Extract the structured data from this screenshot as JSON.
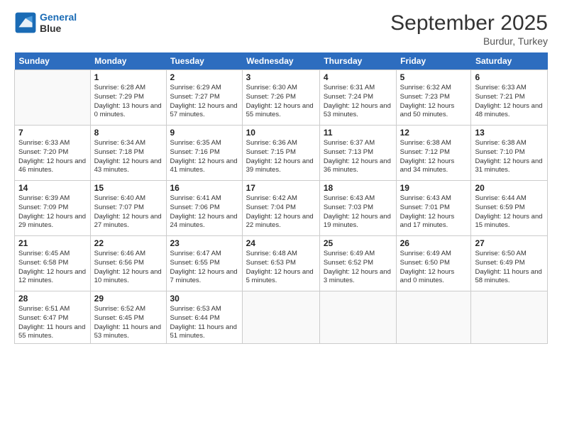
{
  "logo": {
    "line1": "General",
    "line2": "Blue"
  },
  "title": "September 2025",
  "subtitle": "Burdur, Turkey",
  "headers": [
    "Sunday",
    "Monday",
    "Tuesday",
    "Wednesday",
    "Thursday",
    "Friday",
    "Saturday"
  ],
  "weeks": [
    [
      {
        "day": "",
        "sunrise": "",
        "sunset": "",
        "daylight": ""
      },
      {
        "day": "1",
        "sunrise": "Sunrise: 6:28 AM",
        "sunset": "Sunset: 7:29 PM",
        "daylight": "Daylight: 13 hours and 0 minutes."
      },
      {
        "day": "2",
        "sunrise": "Sunrise: 6:29 AM",
        "sunset": "Sunset: 7:27 PM",
        "daylight": "Daylight: 12 hours and 57 minutes."
      },
      {
        "day": "3",
        "sunrise": "Sunrise: 6:30 AM",
        "sunset": "Sunset: 7:26 PM",
        "daylight": "Daylight: 12 hours and 55 minutes."
      },
      {
        "day": "4",
        "sunrise": "Sunrise: 6:31 AM",
        "sunset": "Sunset: 7:24 PM",
        "daylight": "Daylight: 12 hours and 53 minutes."
      },
      {
        "day": "5",
        "sunrise": "Sunrise: 6:32 AM",
        "sunset": "Sunset: 7:23 PM",
        "daylight": "Daylight: 12 hours and 50 minutes."
      },
      {
        "day": "6",
        "sunrise": "Sunrise: 6:33 AM",
        "sunset": "Sunset: 7:21 PM",
        "daylight": "Daylight: 12 hours and 48 minutes."
      }
    ],
    [
      {
        "day": "7",
        "sunrise": "Sunrise: 6:33 AM",
        "sunset": "Sunset: 7:20 PM",
        "daylight": "Daylight: 12 hours and 46 minutes."
      },
      {
        "day": "8",
        "sunrise": "Sunrise: 6:34 AM",
        "sunset": "Sunset: 7:18 PM",
        "daylight": "Daylight: 12 hours and 43 minutes."
      },
      {
        "day": "9",
        "sunrise": "Sunrise: 6:35 AM",
        "sunset": "Sunset: 7:16 PM",
        "daylight": "Daylight: 12 hours and 41 minutes."
      },
      {
        "day": "10",
        "sunrise": "Sunrise: 6:36 AM",
        "sunset": "Sunset: 7:15 PM",
        "daylight": "Daylight: 12 hours and 39 minutes."
      },
      {
        "day": "11",
        "sunrise": "Sunrise: 6:37 AM",
        "sunset": "Sunset: 7:13 PM",
        "daylight": "Daylight: 12 hours and 36 minutes."
      },
      {
        "day": "12",
        "sunrise": "Sunrise: 6:38 AM",
        "sunset": "Sunset: 7:12 PM",
        "daylight": "Daylight: 12 hours and 34 minutes."
      },
      {
        "day": "13",
        "sunrise": "Sunrise: 6:38 AM",
        "sunset": "Sunset: 7:10 PM",
        "daylight": "Daylight: 12 hours and 31 minutes."
      }
    ],
    [
      {
        "day": "14",
        "sunrise": "Sunrise: 6:39 AM",
        "sunset": "Sunset: 7:09 PM",
        "daylight": "Daylight: 12 hours and 29 minutes."
      },
      {
        "day": "15",
        "sunrise": "Sunrise: 6:40 AM",
        "sunset": "Sunset: 7:07 PM",
        "daylight": "Daylight: 12 hours and 27 minutes."
      },
      {
        "day": "16",
        "sunrise": "Sunrise: 6:41 AM",
        "sunset": "Sunset: 7:06 PM",
        "daylight": "Daylight: 12 hours and 24 minutes."
      },
      {
        "day": "17",
        "sunrise": "Sunrise: 6:42 AM",
        "sunset": "Sunset: 7:04 PM",
        "daylight": "Daylight: 12 hours and 22 minutes."
      },
      {
        "day": "18",
        "sunrise": "Sunrise: 6:43 AM",
        "sunset": "Sunset: 7:03 PM",
        "daylight": "Daylight: 12 hours and 19 minutes."
      },
      {
        "day": "19",
        "sunrise": "Sunrise: 6:43 AM",
        "sunset": "Sunset: 7:01 PM",
        "daylight": "Daylight: 12 hours and 17 minutes."
      },
      {
        "day": "20",
        "sunrise": "Sunrise: 6:44 AM",
        "sunset": "Sunset: 6:59 PM",
        "daylight": "Daylight: 12 hours and 15 minutes."
      }
    ],
    [
      {
        "day": "21",
        "sunrise": "Sunrise: 6:45 AM",
        "sunset": "Sunset: 6:58 PM",
        "daylight": "Daylight: 12 hours and 12 minutes."
      },
      {
        "day": "22",
        "sunrise": "Sunrise: 6:46 AM",
        "sunset": "Sunset: 6:56 PM",
        "daylight": "Daylight: 12 hours and 10 minutes."
      },
      {
        "day": "23",
        "sunrise": "Sunrise: 6:47 AM",
        "sunset": "Sunset: 6:55 PM",
        "daylight": "Daylight: 12 hours and 7 minutes."
      },
      {
        "day": "24",
        "sunrise": "Sunrise: 6:48 AM",
        "sunset": "Sunset: 6:53 PM",
        "daylight": "Daylight: 12 hours and 5 minutes."
      },
      {
        "day": "25",
        "sunrise": "Sunrise: 6:49 AM",
        "sunset": "Sunset: 6:52 PM",
        "daylight": "Daylight: 12 hours and 3 minutes."
      },
      {
        "day": "26",
        "sunrise": "Sunrise: 6:49 AM",
        "sunset": "Sunset: 6:50 PM",
        "daylight": "Daylight: 12 hours and 0 minutes."
      },
      {
        "day": "27",
        "sunrise": "Sunrise: 6:50 AM",
        "sunset": "Sunset: 6:49 PM",
        "daylight": "Daylight: 11 hours and 58 minutes."
      }
    ],
    [
      {
        "day": "28",
        "sunrise": "Sunrise: 6:51 AM",
        "sunset": "Sunset: 6:47 PM",
        "daylight": "Daylight: 11 hours and 55 minutes."
      },
      {
        "day": "29",
        "sunrise": "Sunrise: 6:52 AM",
        "sunset": "Sunset: 6:45 PM",
        "daylight": "Daylight: 11 hours and 53 minutes."
      },
      {
        "day": "30",
        "sunrise": "Sunrise: 6:53 AM",
        "sunset": "Sunset: 6:44 PM",
        "daylight": "Daylight: 11 hours and 51 minutes."
      },
      {
        "day": "",
        "sunrise": "",
        "sunset": "",
        "daylight": ""
      },
      {
        "day": "",
        "sunrise": "",
        "sunset": "",
        "daylight": ""
      },
      {
        "day": "",
        "sunrise": "",
        "sunset": "",
        "daylight": ""
      },
      {
        "day": "",
        "sunrise": "",
        "sunset": "",
        "daylight": ""
      }
    ]
  ]
}
